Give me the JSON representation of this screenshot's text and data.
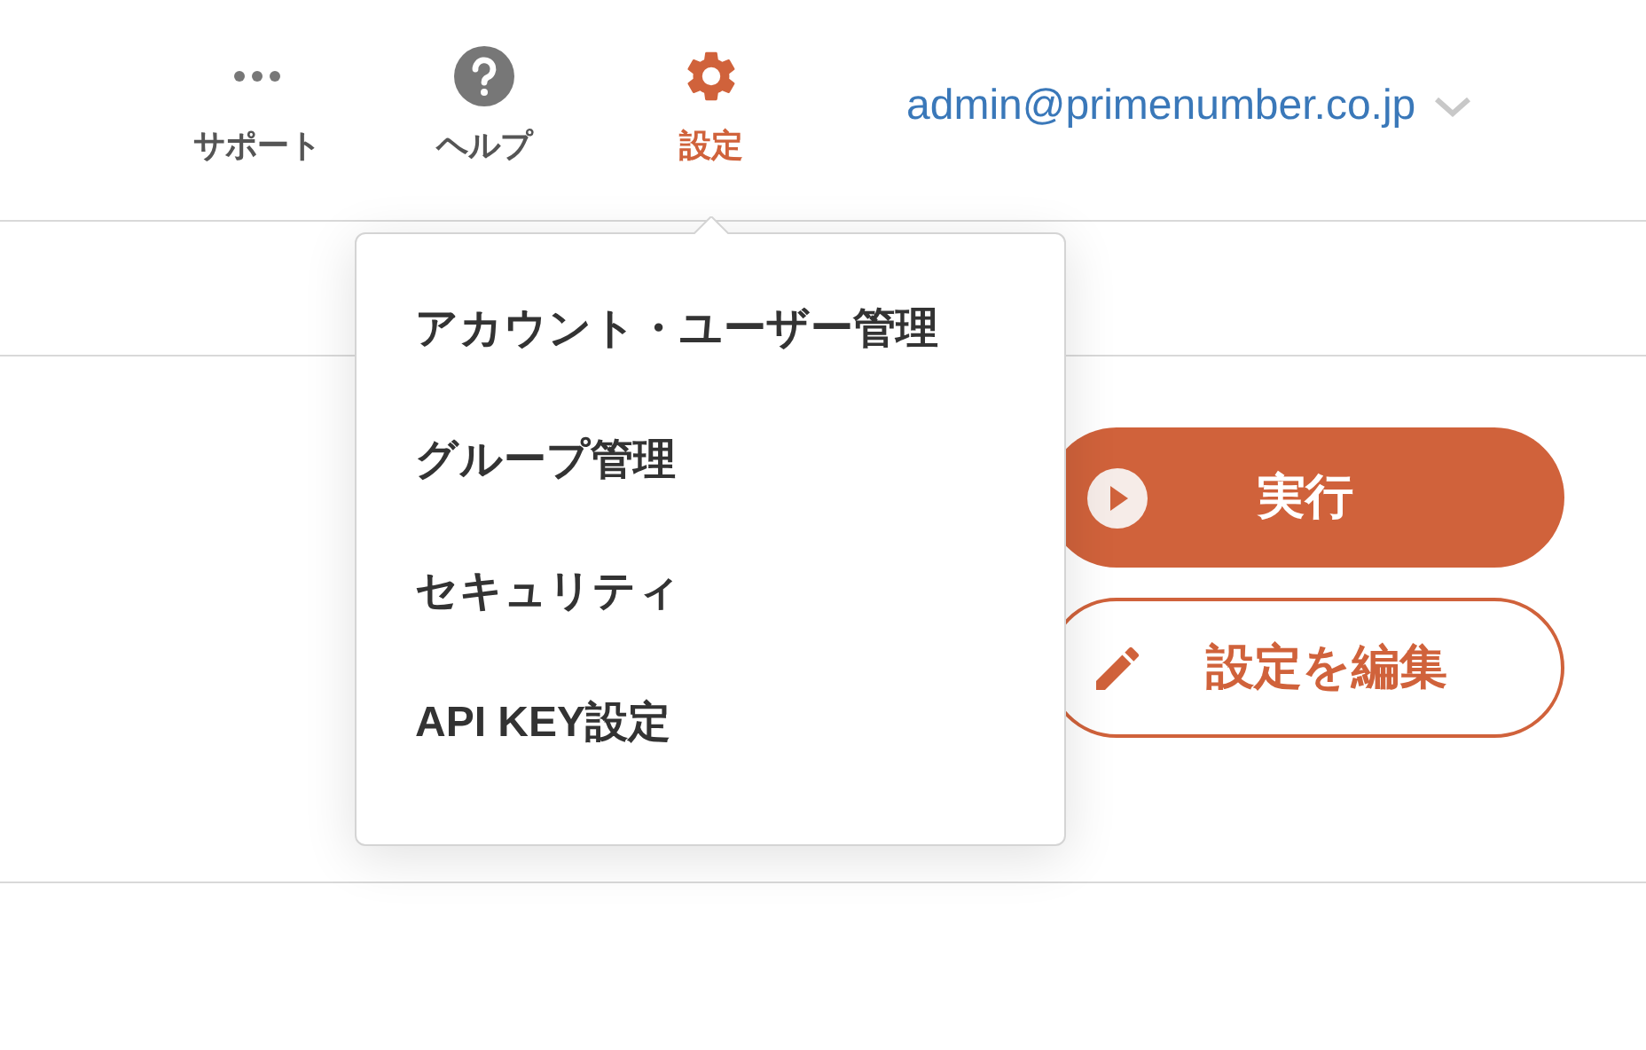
{
  "nav": [
    {
      "kind": "dots",
      "label": "サポート",
      "selected": false
    },
    {
      "kind": "help",
      "label": "ヘルプ",
      "selected": false
    },
    {
      "kind": "gear",
      "label": "設定",
      "selected": true
    }
  ],
  "account": {
    "email": "admin@primenumber.co.jp"
  },
  "settings_menu": {
    "items": [
      "アカウント・ユーザー管理",
      "グループ管理",
      "セキュリティ",
      "API KEY設定"
    ]
  },
  "actions": [
    {
      "kind": "primary",
      "label": "実行"
    },
    {
      "kind": "outline",
      "label": "設定を編集"
    }
  ]
}
